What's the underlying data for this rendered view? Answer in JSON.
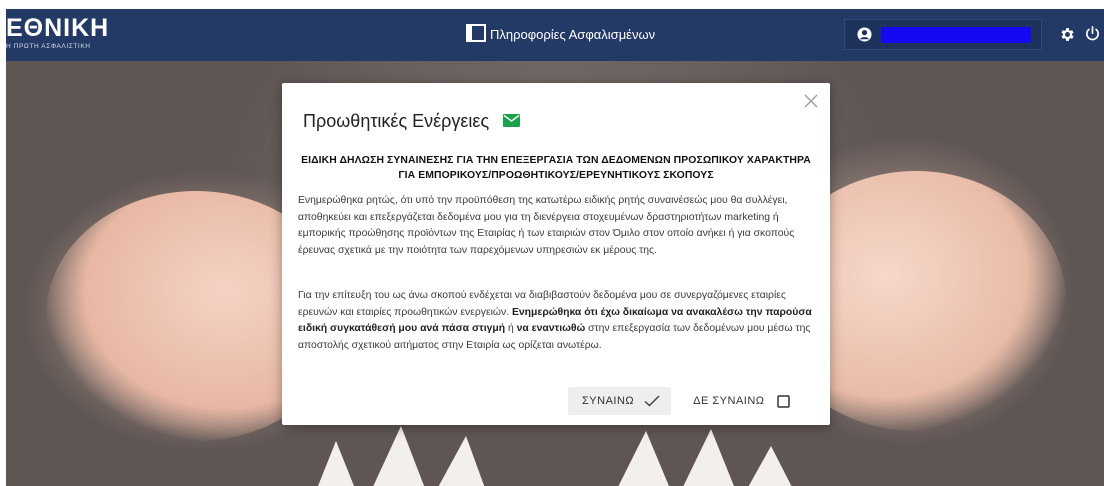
{
  "brand": {
    "name": "ΕΘΝΙΚΗ",
    "subtitle": "Η ΠΡΩΤΗ ΑΣΦΑΛΙΣΤΙΚΗ"
  },
  "header": {
    "center_title": "Πληροφορίες Ασφαλισμένων",
    "center_icon": "window-icon",
    "user_icon": "user-circle-icon",
    "settings_icon": "gear-icon",
    "power_icon": "power-icon"
  },
  "modal": {
    "title": "Προωθητικές Ενέργειες",
    "title_icon": "mail-icon",
    "heading": "ΕΙΔΙΚΗ ΔΗΛΩΣΗ ΣΥΝΑΙΝΕΣΗΣ ΓΙΑ ΤΗΝ ΕΠΕΞΕΡΓΑΣΙΑ ΤΩΝ ΔΕΔΟΜΕΝΩΝ ΠΡΟΣΩΠΙΚΟΥ ΧΑΡΑΚΤΗΡΑ ΓΙΑ ΕΜΠΟΡΙΚΟΥΣ/ΠΡΟΩΘΗΤΙΚΟΥΣ/ΕΡΕΥΝΗΤΙΚΟΥΣ ΣΚΟΠΟΥΣ",
    "paragraph1": "Ενημερώθηκα ρητώς, ότι υπό την προϋπόθεση της κατωτέρω ειδικής ρητής συναινέσεώς μου θα συλλέγει, αποθηκεύει και επεξεργάζεται δεδομένα μου για τη διενέργεια στοχευμένων δραστηριοτήτων marketing ή εμπορικής προώθησης προϊόντων της Εταιρίας ή των εταιριών στον Όμιλο στον οποίο ανήκει ή για σκοπούς έρευνας σχετικά με την ποιότητα των παρεχόμενων υπηρεσιών εκ μέρους της.",
    "paragraph2": {
      "part1": "Για την επίτευξη του ως άνω σκοπού ενδέχεται να διαβιβαστούν δεδομένα μου σε συνεργαζόμενες εταιρίες ερευνών και εταιρίες προωθητικών ενεργειών. ",
      "bold1": "Ενημερώθηκα ότι έχω δικαίωμα να ανακαλέσω την παρούσα ειδική συγκατάθεσή μου ανά πάσα στιγμή",
      "part2": " ή ",
      "bold2": "να εναντιωθώ",
      "part3": " στην επεξεργασία των δεδομένων μου μέσω της αποστολής σχετικού αιτήματος στην Εταιρία ως ορίζεται ανωτέρω."
    },
    "accept_label": "ΣΥΝΑΙΝΩ",
    "accept_icon": "check-icon",
    "decline_label": "ΔΕ ΣΥΝΑΙΝΩ",
    "decline_icon": "checkbox-icon",
    "close_icon": "close-icon"
  },
  "colors": {
    "topbar": "#233a67",
    "redaction": "#1409f2",
    "mail_icon": "#1aa34a"
  }
}
